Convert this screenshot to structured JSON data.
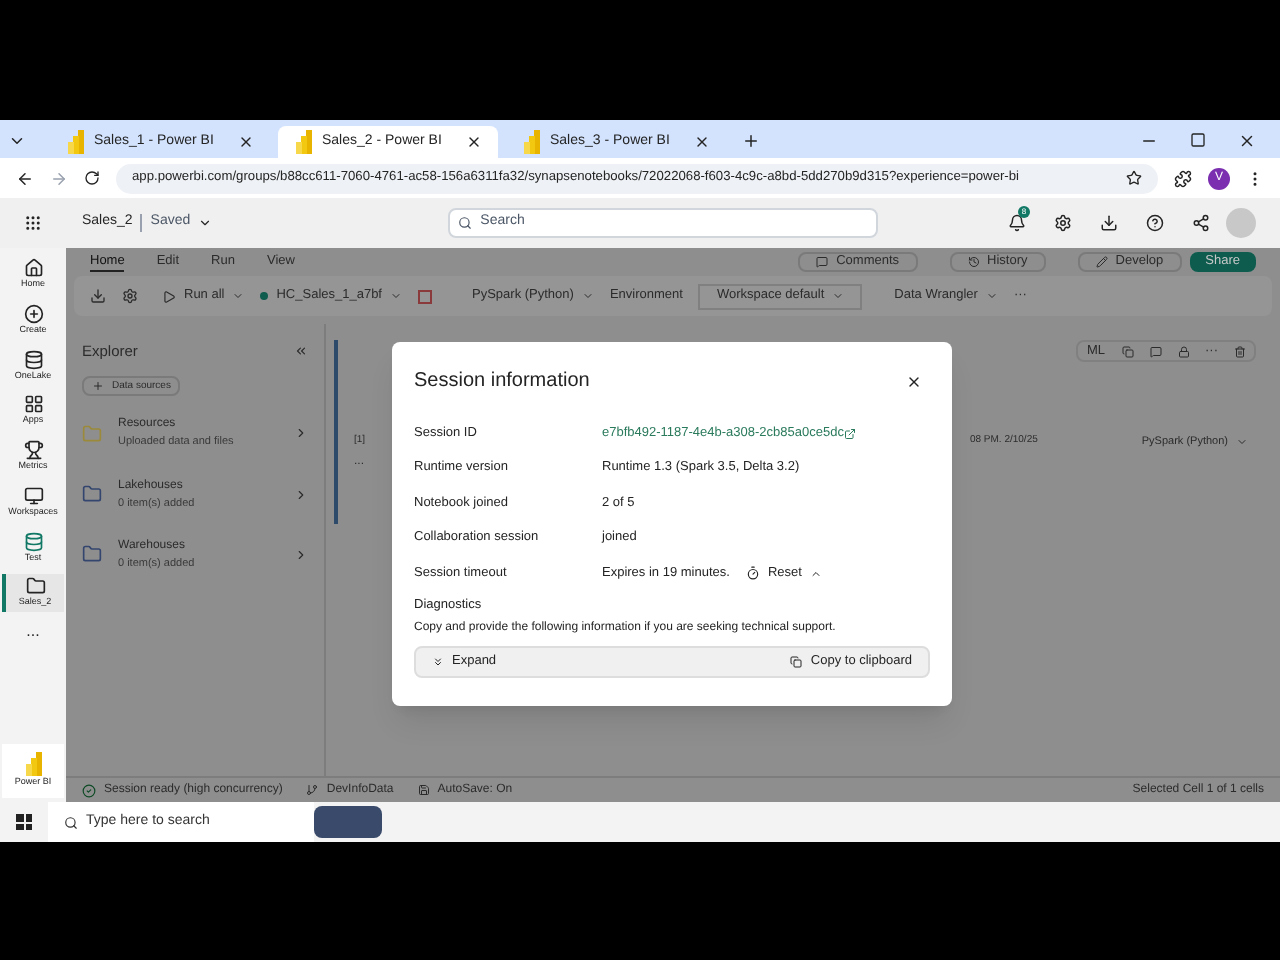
{
  "browser": {
    "tabs": [
      {
        "title": "Sales_1 - Power BI",
        "selected": false
      },
      {
        "title": "Sales_2 - Power BI",
        "selected": true
      },
      {
        "title": "Sales_3 - Power BI",
        "selected": false
      }
    ],
    "url": "app.powerbi.com/groups/b88cc611-7060-4761-ac58-156a6311fa32/synapsenotebooks/72022068-f603-4c9c-a8bd-5dd270b9d315?experience=power-bi",
    "avatar": "V"
  },
  "app_header": {
    "item": "Sales_2",
    "status": "Saved",
    "search": {
      "placeholder": "Search"
    },
    "notification_count": "8"
  },
  "nav": [
    {
      "label": "Home",
      "selected": false
    },
    {
      "label": "Create",
      "selected": false
    },
    {
      "label": "OneLake",
      "selected": false
    },
    {
      "label": "Apps",
      "selected": false
    },
    {
      "label": "Metrics",
      "selected": false
    },
    {
      "label": "Workspaces",
      "selected": false
    },
    {
      "label": "Test",
      "selected": false
    },
    {
      "label": "Sales_2",
      "selected": true
    }
  ],
  "nav_more": "...",
  "nav_product": "Power BI",
  "ribbon": {
    "tabs": [
      {
        "label": "Home",
        "selected": true
      },
      {
        "label": "Edit",
        "selected": false
      },
      {
        "label": "Run",
        "selected": false
      },
      {
        "label": "View",
        "selected": false
      }
    ],
    "actions": [
      "Comments",
      "History",
      "Develop"
    ],
    "share": "Share",
    "toolbar": {
      "run_all": "Run all",
      "session": "HC_Sales_1_a7bf",
      "language": "PySpark (Python)",
      "environment_label": "Environment",
      "environment": "Workspace default",
      "data_wrangler": "Data Wrangler",
      "more": "···"
    }
  },
  "explorer": {
    "title": "Explorer",
    "add": "Data sources",
    "items": [
      {
        "name": "Resources",
        "detail": "Uploaded data and files"
      },
      {
        "name": "Lakehouses",
        "detail": "0 item(s) added"
      },
      {
        "name": "Warehouses",
        "detail": "0 item(s) added"
      }
    ]
  },
  "cell": {
    "counter": "[1]",
    "more": "...",
    "ml": "ML",
    "toolbar_more": "···",
    "timestamp": "08 PM. 2/10/25",
    "language": "PySpark (Python)"
  },
  "status_bar": {
    "session": "Session ready (high concurrency)",
    "branch": "DevInfoData",
    "autosave": "AutoSave: On",
    "selection": "Selected Cell 1 of 1 cells"
  },
  "dialog": {
    "title": "Session information",
    "rows": [
      {
        "label": "Session ID",
        "value": "e7bfb492-1187-4e4b-a308-2cb85a0ce5dc",
        "kind": "link"
      },
      {
        "label": "Runtime version",
        "value": "Runtime 1.3 (Spark 3.5, Delta 3.2)",
        "kind": "text"
      },
      {
        "label": "Notebook joined",
        "value": "2 of 5",
        "kind": "text"
      },
      {
        "label": "Collaboration session",
        "value": "joined",
        "kind": "text"
      },
      {
        "label": "Session timeout",
        "value": "Expires in 19 minutes.",
        "kind": "timeout",
        "action": "Reset"
      }
    ],
    "diagnostics_title": "Diagnostics",
    "diagnostics_text": "Copy and provide the following information if you are seeking technical support.",
    "expand": "Expand",
    "copy": "Copy to clipboard"
  },
  "taskbar": {
    "search": {
      "placeholder": "Type here to search"
    }
  }
}
